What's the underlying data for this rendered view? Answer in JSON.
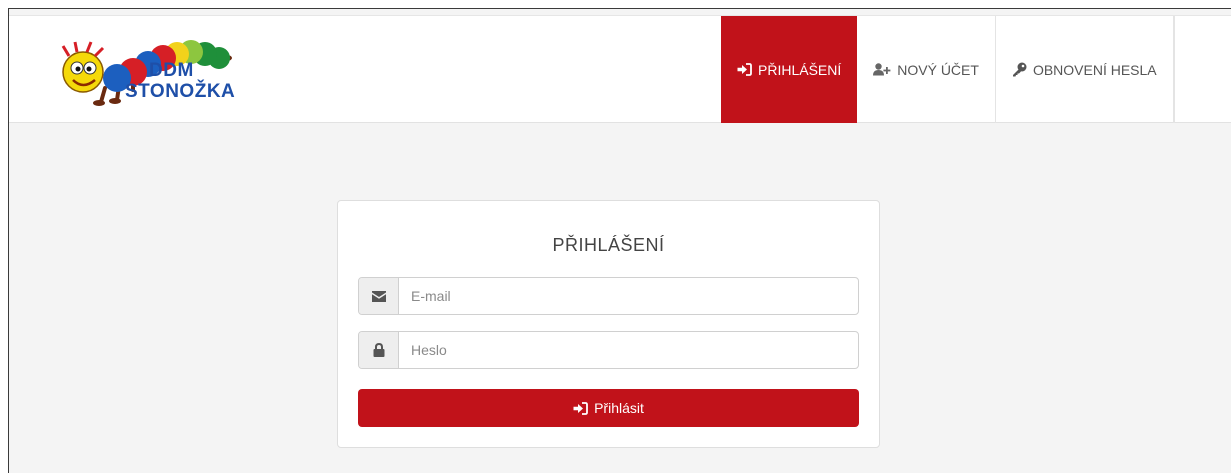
{
  "header": {
    "logo": {
      "line1": "DDM",
      "line2": "STONOŽKA"
    },
    "nav": [
      {
        "label": "PŘIHLÁŠENÍ",
        "icon": "sign-in-icon",
        "active": true
      },
      {
        "label": "NOVÝ ÚČET",
        "icon": "user-plus-icon",
        "active": false
      },
      {
        "label": "OBNOVENÍ HESLA",
        "icon": "key-icon",
        "active": false
      }
    ]
  },
  "login": {
    "title": "PŘIHLÁŠENÍ",
    "email_placeholder": "E-mail",
    "email_icon": "envelope-icon",
    "password_placeholder": "Heslo",
    "password_icon": "lock-icon",
    "submit_label": "Přihlásit",
    "submit_icon": "sign-in-icon"
  },
  "colors": {
    "accent": "#c1121a",
    "background": "#f4f4f4",
    "logo_text": "#1e4fa8"
  }
}
